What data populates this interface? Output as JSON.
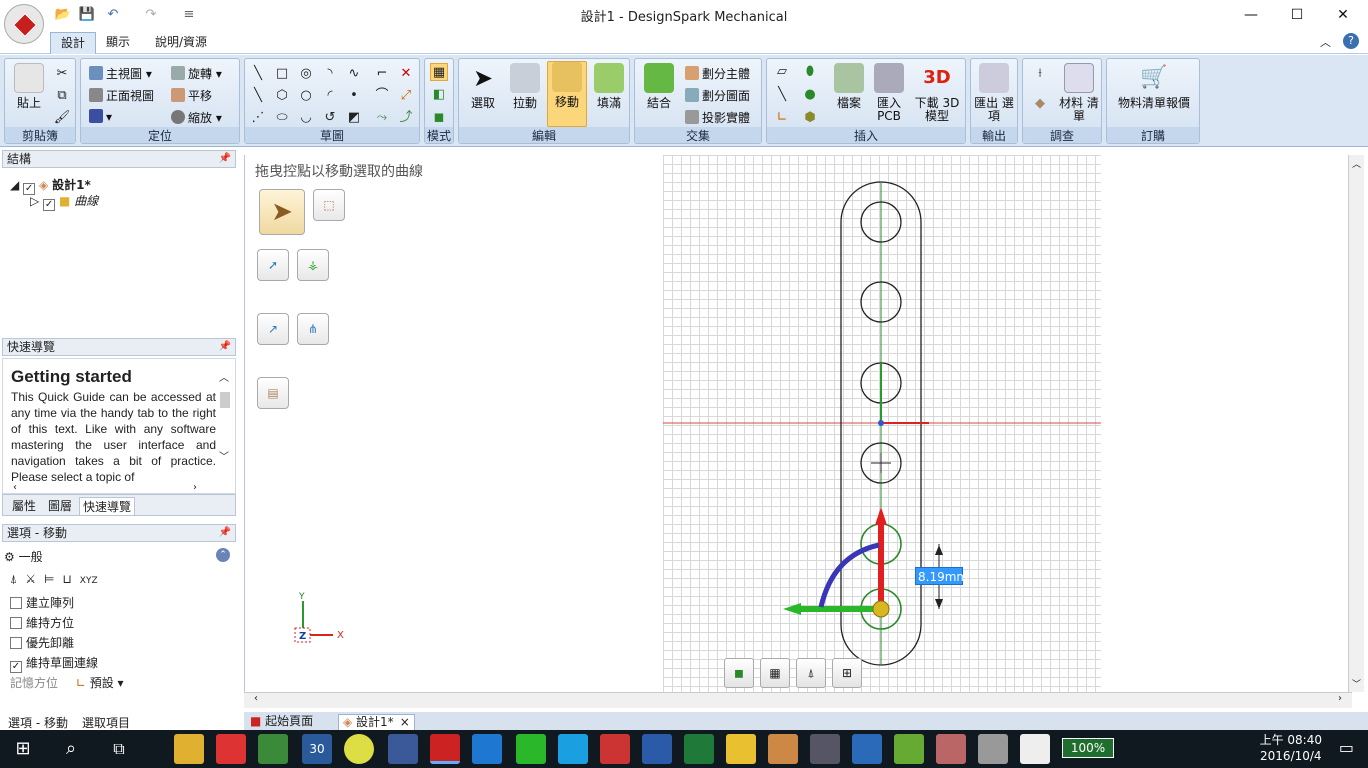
{
  "window": {
    "title": "設計1 - DesignSpark Mechanical",
    "minimize": "—",
    "maximize": "☐",
    "close": "✕"
  },
  "menu": {
    "tabs": [
      "設計",
      "顯示",
      "說明/資源"
    ]
  },
  "ribbon": {
    "clipboard": {
      "label": "剪貼簿",
      "paste": "貼上"
    },
    "orient": {
      "label": "定位",
      "home": "主視圖",
      "front": "正面視圖",
      "rotate": "旋轉",
      "pan": "平移",
      "zoom": "縮放"
    },
    "sketch": {
      "label": "草圖"
    },
    "mode": {
      "label": "模式"
    },
    "edit": {
      "label": "編輯",
      "select": "選取",
      "pull": "拉動",
      "move": "移動",
      "fill": "填滿"
    },
    "intersect": {
      "label": "交集",
      "combine": "結合",
      "split_body": "劃分主體",
      "split_face": "劃分圖面",
      "project": "投影實體"
    },
    "insert": {
      "label": "插入",
      "file": "檔案",
      "import_pcb": "匯入 PCB",
      "download_3d": "下載 3D 模型"
    },
    "output": {
      "label": "輸出",
      "export": "匯出 選項"
    },
    "investigate": {
      "label": "調查",
      "bom": "材料 清單"
    },
    "order": {
      "label": "訂購",
      "quote": "物料清單報價"
    }
  },
  "structure": {
    "header": "結構",
    "root": "設計1*",
    "child": "曲線"
  },
  "guide": {
    "header": "快速導覽",
    "title": "Getting started",
    "body": "This Quick Guide can be accessed at any time via the handy tab to the right of this text. Like with any software mastering the user interface and navigation takes a bit of practice. Please select a topic of"
  },
  "panel_tabs": [
    "屬性",
    "圖層",
    "快速導覽"
  ],
  "options": {
    "header": "選項 - 移動",
    "section": "一般",
    "items": [
      {
        "label": "建立陣列",
        "checked": false
      },
      {
        "label": "維持方位",
        "checked": false
      },
      {
        "label": "優先卸離",
        "checked": false
      },
      {
        "label": "維持草圖連線",
        "checked": true
      }
    ],
    "memory_label": "記憶方位",
    "memory_value": "預設"
  },
  "bottom_tabs": [
    "選項 - 移動",
    "選取項目"
  ],
  "canvas": {
    "hint": "拖曳控點以移動選取的曲線",
    "dimension": "8.19mm",
    "axis_x": "X",
    "axis_y": "Y",
    "axis_z": "Z"
  },
  "doc_tabs": [
    "起始頁面",
    "設計1*"
  ],
  "taskbar": {
    "zoom": "100%",
    "time": "上午 08:40",
    "date": "2016/10/4",
    "calendar": "30"
  }
}
